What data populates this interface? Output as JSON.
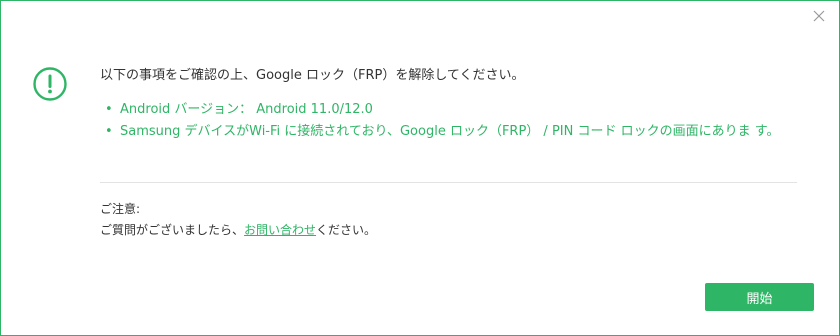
{
  "headline": "以下の事項をご確認の上、Google ロック（FRP）を解除してください。",
  "requirements": [
    "Android バージョン：  Android 11.0/12.0",
    "Samsung デバイスがWi-Fi に接続されており、Google ロック（FRP） / PIN コード ロックの画面にありま す。"
  ],
  "bullet_glyph": "•",
  "notice": {
    "title": "ご注意:",
    "text_before": "ご質問がございましたら、",
    "link": "お問い合わせ",
    "text_after": "ください。"
  },
  "start_button": "開始",
  "icons": {
    "close": "close-icon",
    "alert": "exclamation-circle-icon"
  },
  "colors": {
    "accent": "#2fb566",
    "text": "#333333",
    "divider": "#e3e3e3"
  }
}
